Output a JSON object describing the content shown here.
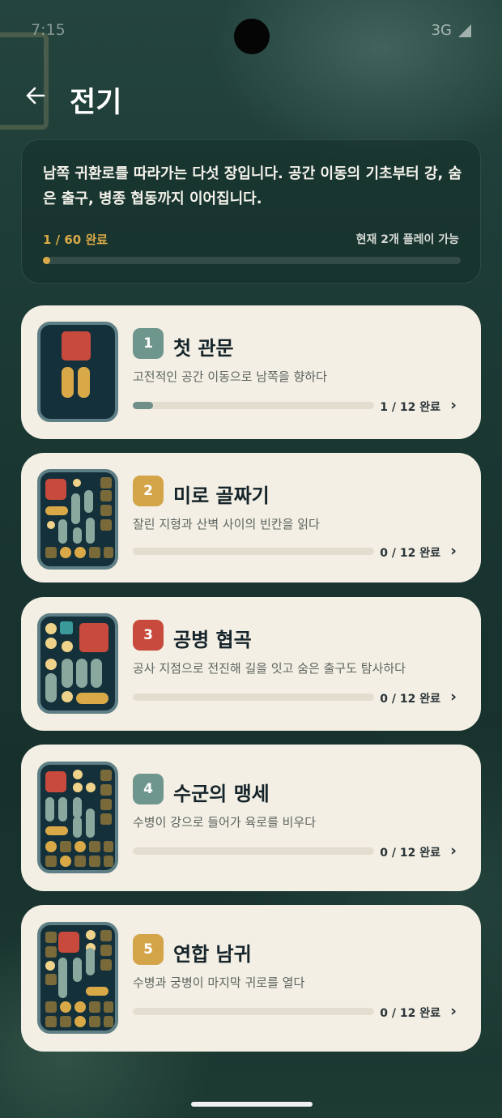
{
  "status_bar": {
    "time": "7:15",
    "network": "3G"
  },
  "header": {
    "title": "전기"
  },
  "summary": {
    "description": "남쪽 귀환로를 따라가는 다섯 장입니다. 공간 이동의 기초부터 강, 숨은 출구, 병종 협동까지 이어집니다.",
    "completed": "1 / 60 완료",
    "playable": "현재 2개 플레이 가능",
    "progress_fraction": 0.0167
  },
  "chapters": [
    {
      "number": "1",
      "title": "첫 관문",
      "subtitle": "고전적인 공간 이동으로 남쪽을 향하다",
      "progress": "1 / 12 완료",
      "progress_fraction": 0.083,
      "badge_color": "#6f968d"
    },
    {
      "number": "2",
      "title": "미로 골짜기",
      "subtitle": "잘린 지형과 산벽 사이의 빈칸을 읽다",
      "progress": "0 / 12 완료",
      "progress_fraction": 0,
      "badge_color": "#d4a449"
    },
    {
      "number": "3",
      "title": "공병 협곡",
      "subtitle": "공사 지점으로 전진해 길을 잇고 숨은 출구도 탐사하다",
      "progress": "0 / 12 완료",
      "progress_fraction": 0,
      "badge_color": "#c84a3c"
    },
    {
      "number": "4",
      "title": "수군의 맹세",
      "subtitle": "수병이 강으로 들어가 육로를 비우다",
      "progress": "0 / 12 완료",
      "progress_fraction": 0,
      "badge_color": "#6f968d"
    },
    {
      "number": "5",
      "title": "연합 남귀",
      "subtitle": "수병과 궁병이 마지막 귀로를 열다",
      "progress": "0 / 12 완료",
      "progress_fraction": 0,
      "badge_color": "#d4a449"
    }
  ]
}
